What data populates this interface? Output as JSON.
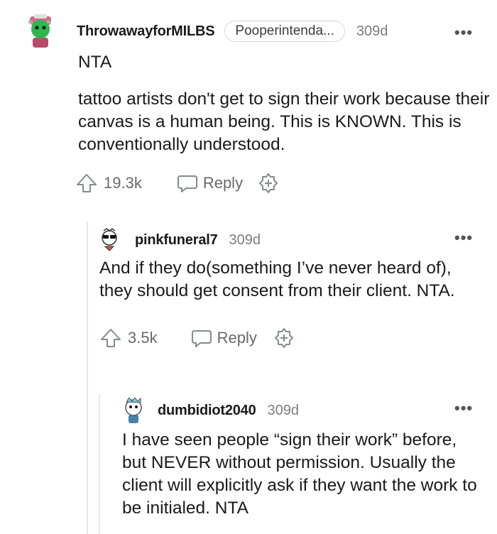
{
  "comments": [
    {
      "username": "ThrowawayforMILBS",
      "flair": "Pooperintenda...",
      "age": "309d",
      "more": "•••",
      "paragraphs": [
        "NTA",
        "tattoo artists don't get to sign their work because their canvas is a human being. This is KNOWN. This is conventionally understood."
      ],
      "votes": "19.3k",
      "reply_label": "Reply"
    },
    {
      "username": "pinkfuneral7",
      "age": "309d",
      "more": "•••",
      "paragraphs": [
        "And if they do(something I’ve never heard of), they should get consent from their client. NTA."
      ],
      "votes": "3.5k",
      "reply_label": "Reply"
    },
    {
      "username": "dumbidiot2040",
      "age": "309d",
      "more": "•••",
      "paragraphs": [
        "I have seen people “sign their work” before, but NEVER without permission. Usually the client will explicitly ask if they want the work to be initialed. NTA"
      ]
    }
  ],
  "icons": {
    "upvote": "upvote-icon",
    "reply": "reply-icon",
    "award": "award-icon",
    "more": "more-options-icon"
  }
}
